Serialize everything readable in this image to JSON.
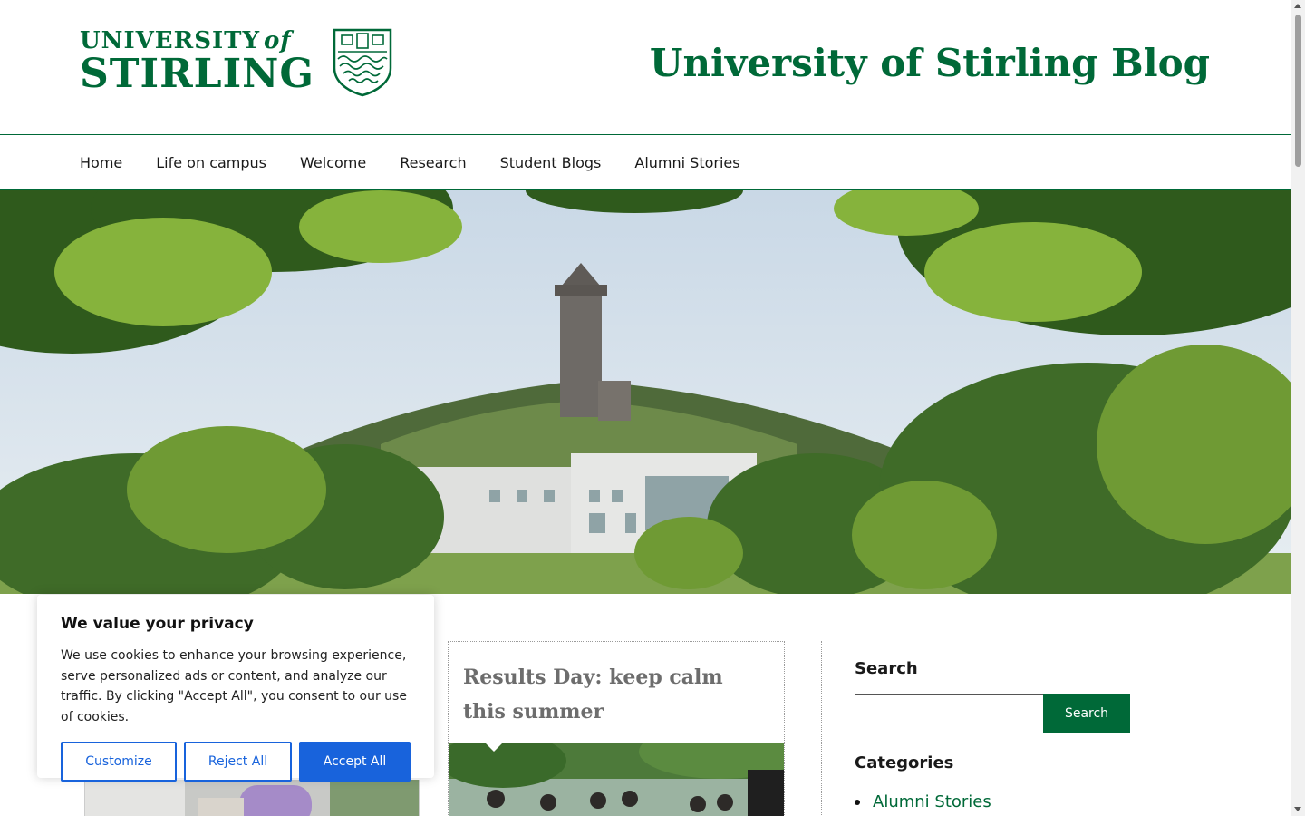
{
  "header": {
    "logo_line1": "UNIVERSITY",
    "logo_of": "of",
    "logo_line2": "STIRLING",
    "blog_title": "University of Stirling Blog"
  },
  "nav": {
    "items": [
      "Home",
      "Life on campus",
      "Welcome",
      "Research",
      "Student Blogs",
      "Alumni Stories"
    ]
  },
  "hero": {
    "icon": "campus-photo"
  },
  "post": {
    "title": "Results Day: keep calm this summer"
  },
  "sidebar": {
    "search_heading": "Search",
    "search_input_value": "",
    "search_button": "Search",
    "categories_heading": "Categories",
    "categories": [
      "Alumni Stories"
    ]
  },
  "cookie": {
    "title": "We value your privacy",
    "text": "We use cookies to enhance your browsing experience, serve personalized ads or content, and analyze our traffic. By clicking \"Accept All\", you consent to our use of cookies.",
    "customize": "Customize",
    "reject": "Reject All",
    "accept": "Accept All"
  },
  "colors": {
    "brand_green": "#006938",
    "cookie_blue": "#1863dc"
  }
}
